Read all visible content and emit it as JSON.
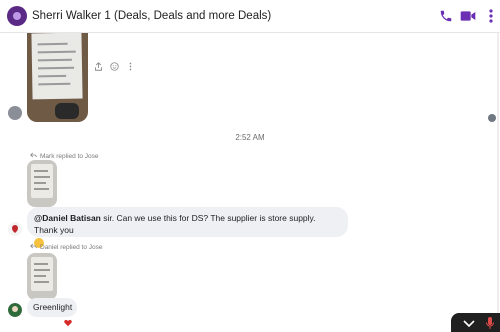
{
  "header": {
    "title": "Sherri Walker 1 (Deals, Deals and more Deals)",
    "accent": "#6b2fb3",
    "icons": [
      "phone-icon",
      "video-icon",
      "more-icon"
    ]
  },
  "messages": {
    "timestamp": "2:52 AM",
    "reply1_label": "Mark replied to Jose",
    "reply2_label": "Daniel replied to Jose",
    "bubble1": {
      "mention": "@Daniel Batisan",
      "text": " sir. Can we use this for DS? The supplier is store supply. Thank you"
    },
    "bubble2": {
      "text": "Greenlight"
    }
  }
}
